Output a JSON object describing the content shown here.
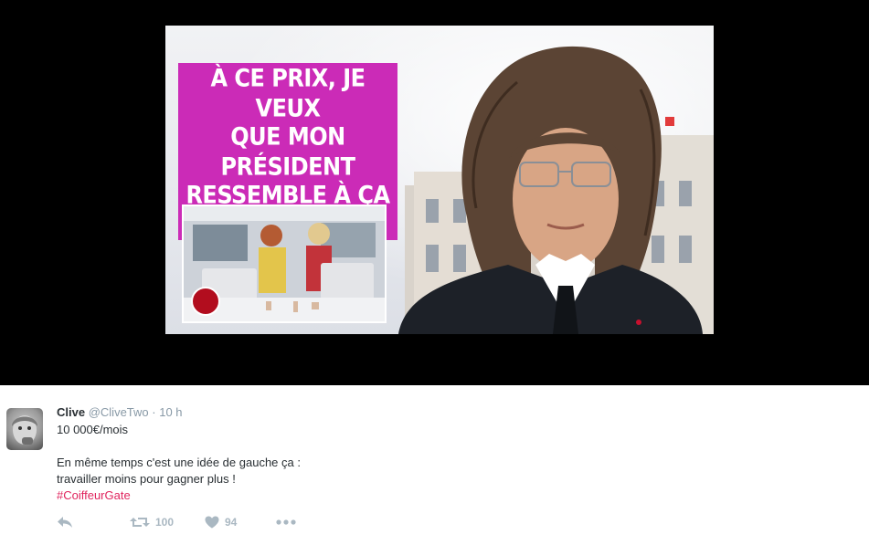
{
  "media": {
    "caption_lines": [
      "À CE PRIX, JE VEUX",
      "QUE MON PRÉSIDENT",
      "RESSEMBLE À ÇA !"
    ],
    "accent_color": "#cb2bb7"
  },
  "tweet": {
    "display_name": "Clive",
    "handle": "@CliveTwo",
    "separator": "·",
    "timestamp": "10 h",
    "lines": [
      "10 000€/mois",
      "En même temps c'est une idée de gauche ça :",
      "travailler moins pour gagner plus !"
    ],
    "hashtag": "#CoiffeurGate",
    "hashtag_color": "#e0245e",
    "actions": {
      "reply_icon": "reply-icon",
      "retweet_icon": "retweet-icon",
      "retweet_count": "100",
      "like_icon": "heart-icon",
      "like_count": "94",
      "more_icon": "more-icon"
    }
  }
}
